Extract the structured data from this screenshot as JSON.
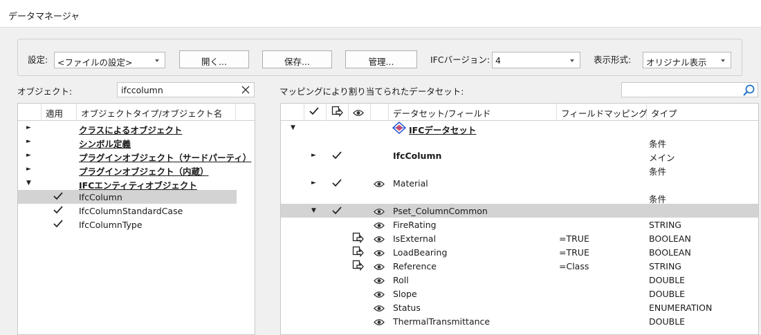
{
  "window": {
    "title": "データマネージャ"
  },
  "toolbar": {
    "settings_label": "設定:",
    "settings_value": "<ファイルの設定>",
    "open_button": "開く...",
    "save_button": "保存...",
    "manage_button": "管理...",
    "ifc_version_label": "IFCバージョン:",
    "ifc_version_value": "4",
    "display_format_label": "表示形式:",
    "display_format_value": "オリジナル表示"
  },
  "objects_panel": {
    "label": "オブジェクト:",
    "search_value": "ifccolumn",
    "columns": {
      "apply": "適用",
      "type_name": "オブジェクトタイプ/オブジェクト名"
    },
    "rows": [
      {
        "label": "クラスによるオブジェクト"
      },
      {
        "label": "シンボル定義"
      },
      {
        "label": "プラグインオブジェクト（サードパーティ）"
      },
      {
        "label": "プラグインオブジェクト（内蔵）"
      },
      {
        "label": "IFCエンティティオブジェクト"
      },
      {
        "label": "IfcColumn"
      },
      {
        "label": "IfcColumnStandardCase"
      },
      {
        "label": "IfcColumnType"
      }
    ]
  },
  "mapping_panel": {
    "label": "マッピングにより割り当てられたデータセット:",
    "search_placeholder": "",
    "columns": {
      "dataset_field": "データセット/フィールド",
      "field_mapping": "フィールドマッピング",
      "type": "タイプ"
    },
    "rows": [
      {
        "name": "IFCデータセット",
        "mapping": "",
        "type": ""
      },
      {
        "name": "",
        "mapping": "",
        "type": "条件"
      },
      {
        "name": "IfcColumn",
        "mapping": "",
        "type": "メイン"
      },
      {
        "name": "",
        "mapping": "",
        "type": "条件"
      },
      {
        "name": "Material",
        "mapping": "",
        "type": ""
      },
      {
        "name": "",
        "mapping": "",
        "type": "条件"
      },
      {
        "name": "Pset_ColumnCommon",
        "mapping": "",
        "type": ""
      },
      {
        "name": "FireRating",
        "mapping": "",
        "type": "STRING"
      },
      {
        "name": "IsExternal",
        "mapping": "=TRUE",
        "type": "BOOLEAN"
      },
      {
        "name": "LoadBearing",
        "mapping": "=TRUE",
        "type": "BOOLEAN"
      },
      {
        "name": "Reference",
        "mapping": "=Class",
        "type": "STRING"
      },
      {
        "name": "Roll",
        "mapping": "",
        "type": "DOUBLE"
      },
      {
        "name": "Slope",
        "mapping": "",
        "type": "DOUBLE"
      },
      {
        "name": "Status",
        "mapping": "",
        "type": "ENUMERATION"
      },
      {
        "name": "ThermalTransmittance",
        "mapping": "",
        "type": "DOUBLE"
      }
    ]
  },
  "icons": {
    "check": "check-icon",
    "eye": "eye-icon",
    "mapping": "mapping-icon",
    "search": "search-icon",
    "clear": "clear-icon",
    "dataset": "dataset-icon"
  }
}
